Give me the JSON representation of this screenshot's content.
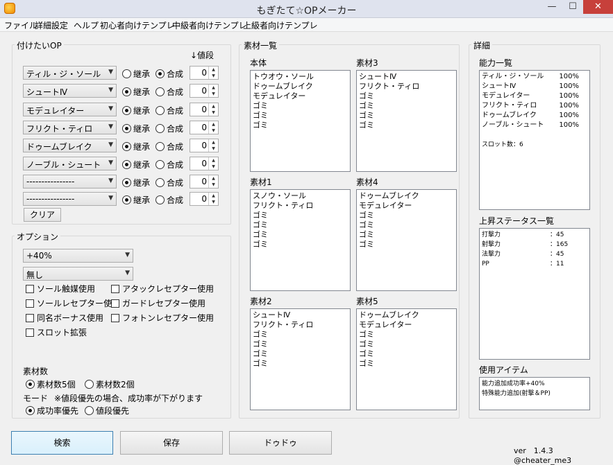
{
  "window": {
    "title": "もぎたて☆OPメーカー",
    "min_glyph": "—",
    "max_glyph": "☐",
    "close_glyph": "✕"
  },
  "menu": [
    "ファイル",
    "詳細設定",
    "ヘルプ",
    "初心者向けテンプレ",
    "中級者向けテンプレ",
    "上級者向けテンプレ"
  ],
  "op_group": {
    "label": "付けたいOP",
    "value_header": "↓値段",
    "inherit_label": "継承",
    "combine_label": "合成",
    "rows": [
      {
        "op": "ティル・ジ・ソール",
        "mode": "combine",
        "value": "0"
      },
      {
        "op": "シュートⅣ",
        "mode": "inherit",
        "value": "0"
      },
      {
        "op": "モデュレイター",
        "mode": "inherit",
        "value": "0"
      },
      {
        "op": "フリクト・ティロ",
        "mode": "inherit",
        "value": "0"
      },
      {
        "op": "ドゥームブレイク",
        "mode": "inherit",
        "value": "0"
      },
      {
        "op": "ノーブル・シュート",
        "mode": "inherit",
        "value": "0"
      },
      {
        "op": "----------------",
        "mode": "inherit",
        "value": "0"
      },
      {
        "op": "----------------",
        "mode": "inherit",
        "value": "0"
      }
    ],
    "clear_label": "クリア"
  },
  "options_group": {
    "label": "オプション",
    "rate_select": "+40%",
    "second_select": "無し",
    "checks": [
      {
        "label": "ソール触媒使用",
        "checked": false
      },
      {
        "label": "アタックレセプター使用",
        "checked": false
      },
      {
        "label": "ソールレセプター使用",
        "checked": false
      },
      {
        "label": "ガードレセプター使用",
        "checked": false
      },
      {
        "label": "同名ボーナス使用",
        "checked": false
      },
      {
        "label": "フォトンレセプター使用",
        "checked": false
      },
      {
        "label": "スロット拡張",
        "checked": false
      }
    ],
    "material_count_label": "素材数",
    "material_count_options": [
      {
        "label": "素材数5個",
        "selected": true
      },
      {
        "label": "素材数2個",
        "selected": false
      }
    ],
    "mode_label": "モード",
    "mode_note": "※値段優先の場合、成功率が下がります",
    "mode_options": [
      {
        "label": "成功率優先",
        "selected": true
      },
      {
        "label": "値段優先",
        "selected": false
      }
    ]
  },
  "materials_group": {
    "label": "素材一覧",
    "boxes": [
      {
        "title": "本体",
        "items": [
          "トウオウ・ソール",
          "ドゥームブレイク",
          "モデュレイター",
          "ゴミ",
          "ゴミ",
          "ゴミ"
        ]
      },
      {
        "title": "素材3",
        "items": [
          "シュートⅣ",
          "フリクト・ティロ",
          "ゴミ",
          "ゴミ",
          "ゴミ",
          "ゴミ"
        ]
      },
      {
        "title": "素材1",
        "items": [
          "スノウ・ソール",
          "フリクト・ティロ",
          "ゴミ",
          "ゴミ",
          "ゴミ",
          "ゴミ"
        ]
      },
      {
        "title": "素材4",
        "items": [
          "ドゥームブレイク",
          "モデュレイター",
          "ゴミ",
          "ゴミ",
          "ゴミ",
          "ゴミ"
        ]
      },
      {
        "title": "素材2",
        "items": [
          "シュートⅣ",
          "フリクト・ティロ",
          "ゴミ",
          "ゴミ",
          "ゴミ",
          "ゴミ"
        ]
      },
      {
        "title": "素材5",
        "items": [
          "ドゥームブレイク",
          "モデュレイター",
          "ゴミ",
          "ゴミ",
          "ゴミ",
          "ゴミ"
        ]
      }
    ]
  },
  "details_group": {
    "label": "詳細",
    "ability_title": "能力一覧",
    "abilities": [
      {
        "name": "ティル・ジ・ソール",
        "rate": "100%"
      },
      {
        "name": "シュートⅣ",
        "rate": "100%"
      },
      {
        "name": "モデュレイター",
        "rate": "100%"
      },
      {
        "name": "フリクト・ティロ",
        "rate": "100%"
      },
      {
        "name": "ドゥームブレイク",
        "rate": "100%"
      },
      {
        "name": "ノーブル・シュート",
        "rate": "100%"
      }
    ],
    "slot_count": "スロット数：6",
    "stats_title": "上昇ステータス一覧",
    "stats": [
      {
        "name": "打撃力",
        "value": "：45"
      },
      {
        "name": "射撃力",
        "value": "：165"
      },
      {
        "name": "法撃力",
        "value": "：45"
      },
      {
        "name": "PP",
        "value": "：11"
      }
    ],
    "items_title": "使用アイテム",
    "items": [
      "能力追加成功率+40%",
      "特殊能力追加(射撃＆PP)"
    ]
  },
  "buttons": {
    "search": "検索",
    "save": "保存",
    "dodou": "ドゥドゥ"
  },
  "version": "ver　1.4.3　@cheater_me3"
}
